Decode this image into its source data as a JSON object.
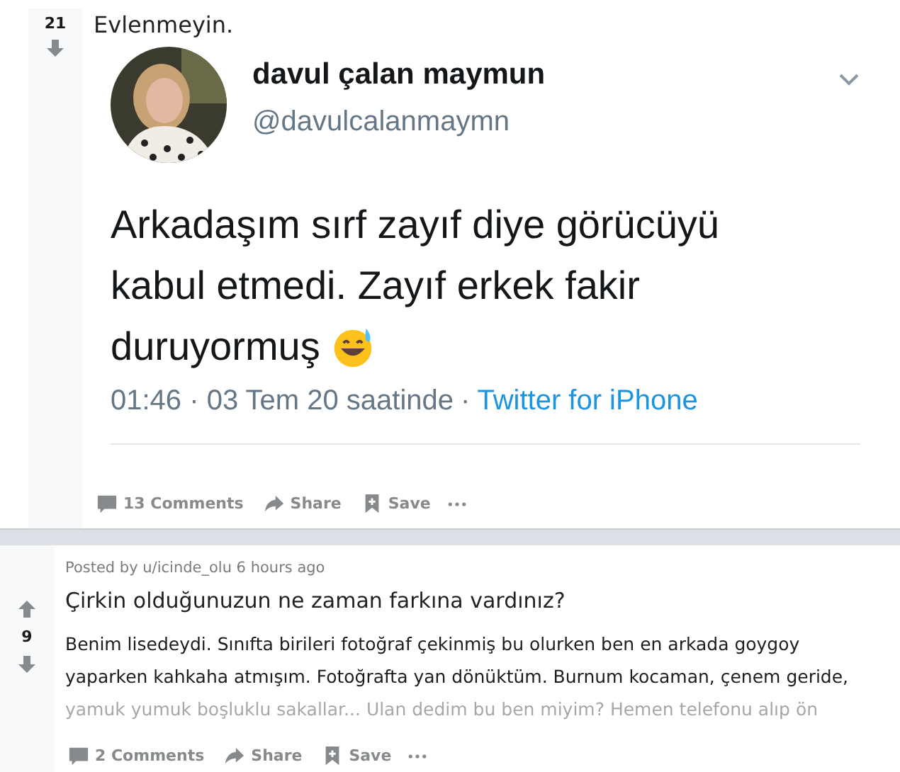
{
  "posts": [
    {
      "kind": "tweet",
      "upvote_shown": false,
      "score": "21",
      "title": "Evlenmeyin.",
      "tweet": {
        "name": "davul çalan maymun",
        "handle": "@davulcalanmaymn",
        "lines": [
          "Arkadaşım sırf zayıf diye görücüyü",
          "kabul etmedi. Zayıf erkek fakir",
          "duruyormuş"
        ],
        "time": "01:46 · 03 Tem 20 saatinde",
        "separator": "·",
        "source": "Twitter for iPhone"
      },
      "actions": {
        "comments": "13 Comments",
        "share": "Share",
        "save": "Save"
      }
    },
    {
      "kind": "text",
      "upvote_shown": true,
      "score": "9",
      "byline": "Posted by u/icinde_olu 6 hours ago",
      "title": "Çirkin olduğunuzun ne zaman farkına vardınız?",
      "body_lines": [
        {
          "text": "Benim lisedeydi. Sınıfta birileri fotoğraf çekinmiş bu olurken ben en arkada goygoy",
          "faded": false
        },
        {
          "text": "yaparken kahkaha atmışım. Fotoğrafta yan dönüktüm. Burnum kocaman, çenem geride,",
          "faded": false
        },
        {
          "text": "yamuk yumuk boşluklu sakallar... Ulan dedim bu ben miyim? Hemen telefonu alıp ön",
          "faded": true
        }
      ],
      "actions": {
        "comments": "2 Comments",
        "share": "Share",
        "save": "Save"
      }
    }
  ]
}
